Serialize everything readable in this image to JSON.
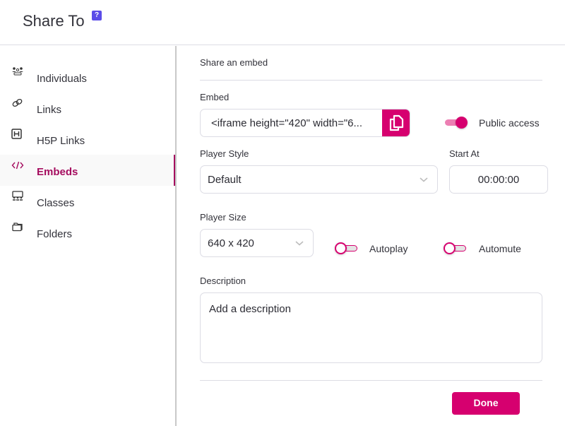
{
  "header": {
    "title": "Share To",
    "help_icon": "question-mark-icon"
  },
  "sidebar": {
    "active": "Embeds",
    "items": [
      {
        "label": "Individuals",
        "icon": "people-group-icon"
      },
      {
        "label": "Links",
        "icon": "link-icon"
      },
      {
        "label": "H5P Links",
        "icon": "h5p-icon"
      },
      {
        "label": "Embeds",
        "icon": "code-icon"
      },
      {
        "label": "Classes",
        "icon": "classroom-icon"
      },
      {
        "label": "Folders",
        "icon": "folder-icon"
      }
    ]
  },
  "main": {
    "section_title": "Share an embed",
    "embed": {
      "label": "Embed",
      "value": "<iframe height=\"420\" width=\"6...",
      "copy_icon": "copy-icon"
    },
    "public_access": {
      "label": "Public access",
      "on": true
    },
    "player_style": {
      "label": "Player Style",
      "value": "Default"
    },
    "start_at": {
      "label": "Start At",
      "value": "00:00:00"
    },
    "player_size": {
      "label": "Player Size",
      "value": "640 x 420"
    },
    "autoplay": {
      "label": "Autoplay",
      "on": false
    },
    "automute": {
      "label": "Automute",
      "on": false
    },
    "description": {
      "label": "Description",
      "placeholder": "Add a description"
    },
    "done_label": "Done"
  },
  "colors": {
    "accent": "#d6006f",
    "active_nav": "#a50d5f",
    "help_badge": "#5b4ce8"
  }
}
